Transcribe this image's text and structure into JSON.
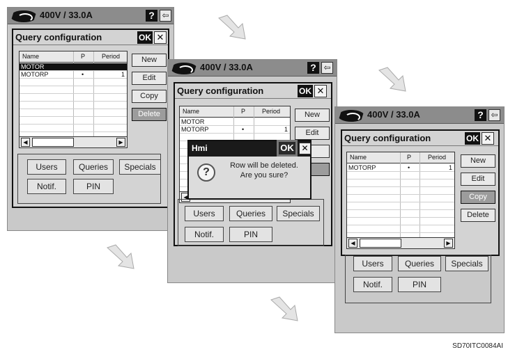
{
  "status_bar": {
    "voltage_current": "400V / 33.0A",
    "help_label": "?",
    "back_label": "⇦"
  },
  "query_window": {
    "title": "Query configuration",
    "ok_label": "OK",
    "close_label": "✕",
    "columns": [
      "Name",
      "P",
      "Period"
    ],
    "buttons": {
      "new": "New",
      "edit": "Edit",
      "copy": "Copy",
      "delete": "Delete"
    }
  },
  "screen1": {
    "rows": [
      {
        "name": "MOTOR",
        "p": "",
        "period": "",
        "selected": true
      },
      {
        "name": "MOTORP",
        "p": "•",
        "period": "1",
        "selected": false
      }
    ],
    "active_button": "delete"
  },
  "screen2": {
    "rows": [
      {
        "name": "MOTOR",
        "p": "",
        "period": ""
      },
      {
        "name": "MOTORP",
        "p": "•",
        "period": "1"
      }
    ],
    "dialog": {
      "title": "Hmi",
      "ok_label": "OK",
      "close_label": "✕",
      "message_line1": "Row will be deleted.",
      "message_line2": "Are you sure?",
      "icon": "question-icon"
    }
  },
  "screen3": {
    "rows": [
      {
        "name": "MOTORP",
        "p": "•",
        "period": "1"
      }
    ],
    "active_button": "copy"
  },
  "bottom_buttons": {
    "users": "Users",
    "queries": "Queries",
    "specials": "Specials",
    "notif": "Notif.",
    "pin": "PIN"
  },
  "scroll": {
    "left": "◀",
    "right": "▶"
  },
  "caption": "SD70ITC0084AI"
}
